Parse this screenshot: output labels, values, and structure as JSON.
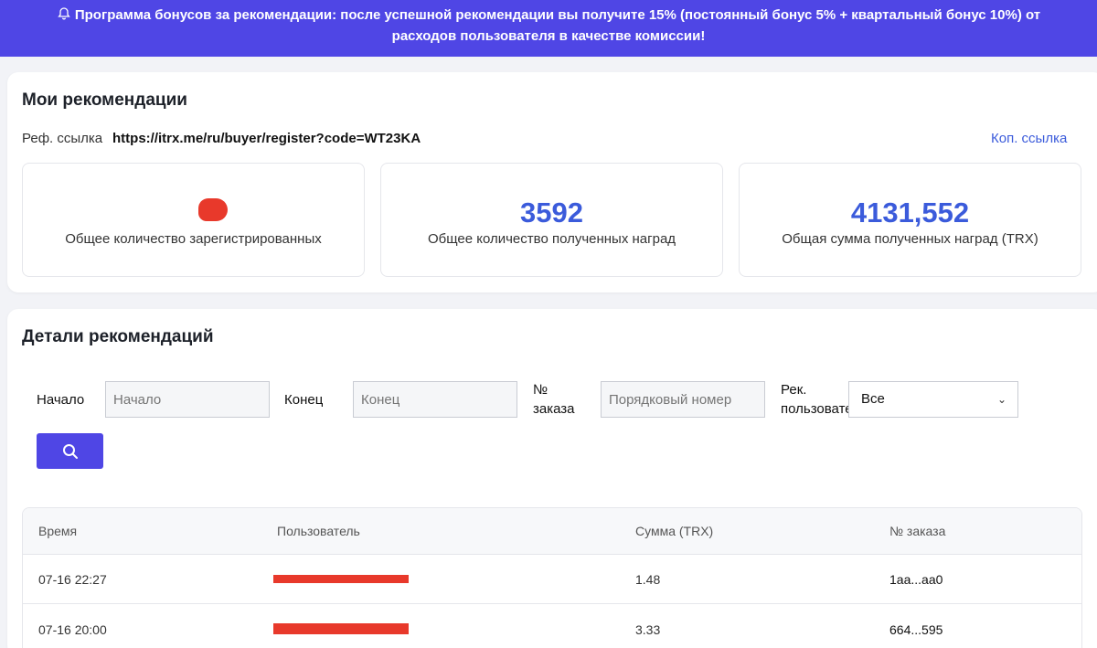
{
  "banner": {
    "text": "Программа бонусов за рекомендации: после успешной рекомендации вы получите 15% (постоянный бонус 5% + квартальный бонус 10%) от расходов пользователя в качестве комиссии!",
    "icon": "bell-icon"
  },
  "referrals": {
    "title": "Мои рекомендации",
    "ref_label": "Реф. ссылка",
    "ref_link": "https://itrx.me/ru/buyer/register?code=WT23KA",
    "copy_label": "Коп. ссылка",
    "stats": [
      {
        "value": "",
        "label": "Общее количество зарегистрированных"
      },
      {
        "value": "3592",
        "label": "Общее количество полученных наград"
      },
      {
        "value": "4131,552",
        "label": "Общая сумма полученных наград (TRX)"
      }
    ]
  },
  "details": {
    "title": "Детали рекомендаций",
    "filters": {
      "start_label": "Начало",
      "start_placeholder": "Начало",
      "end_label": "Конец",
      "end_placeholder": "Конец",
      "order_label_1": "№",
      "order_label_2": "заказа",
      "order_placeholder": "Порядковый номер",
      "user_label_1": "Рек.",
      "user_label_2": "пользовате",
      "user_select_value": "Все"
    },
    "table": {
      "headers": [
        "Время",
        "Пользователь",
        "Сумма (TRX)",
        "№ заказа"
      ],
      "rows": [
        {
          "time": "07-16 22:27",
          "amount": "1.48",
          "order": "1aa...aa0"
        },
        {
          "time": "07-16 20:00",
          "amount": "3.33",
          "order": "664...595"
        }
      ]
    }
  },
  "colors": {
    "accent": "#4f46e5",
    "stat_value": "#3b5bdb",
    "redaction": "#e8392b"
  }
}
